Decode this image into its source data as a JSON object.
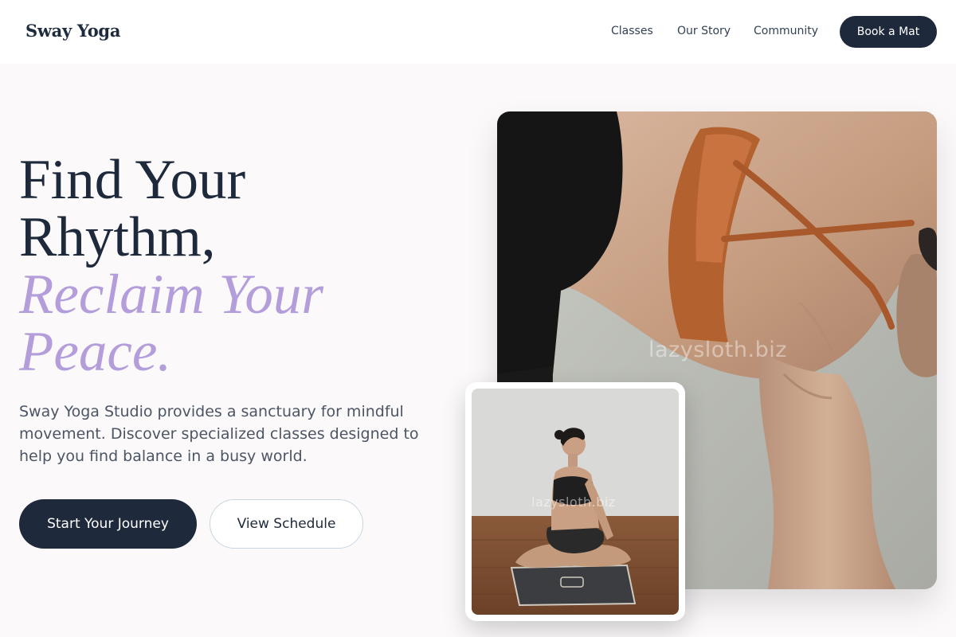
{
  "nav": {
    "logo": "Sway Yoga",
    "links": [
      "Classes",
      "Our Story",
      "Community"
    ],
    "cta": "Book a Mat"
  },
  "hero": {
    "headline_lines": [
      "Find Your",
      "Rhythm,"
    ],
    "accent_lines": [
      "Reclaim Your",
      "Peace."
    ],
    "description": "Sway Yoga Studio provides a sanctuary for mindful movement. Discover specialized classes designed to help you find balance in a busy world.",
    "primary_cta": "Start Your Journey",
    "secondary_cta": "View Schedule"
  },
  "images": {
    "main_photo_watermark": "lazysloth.biz",
    "inset_photo_watermark": "lazysloth.biz"
  },
  "colors": {
    "primary_dark": "#1e293b",
    "accent_lavender": "#b39ddb",
    "page_background": "#fbf9fa"
  }
}
